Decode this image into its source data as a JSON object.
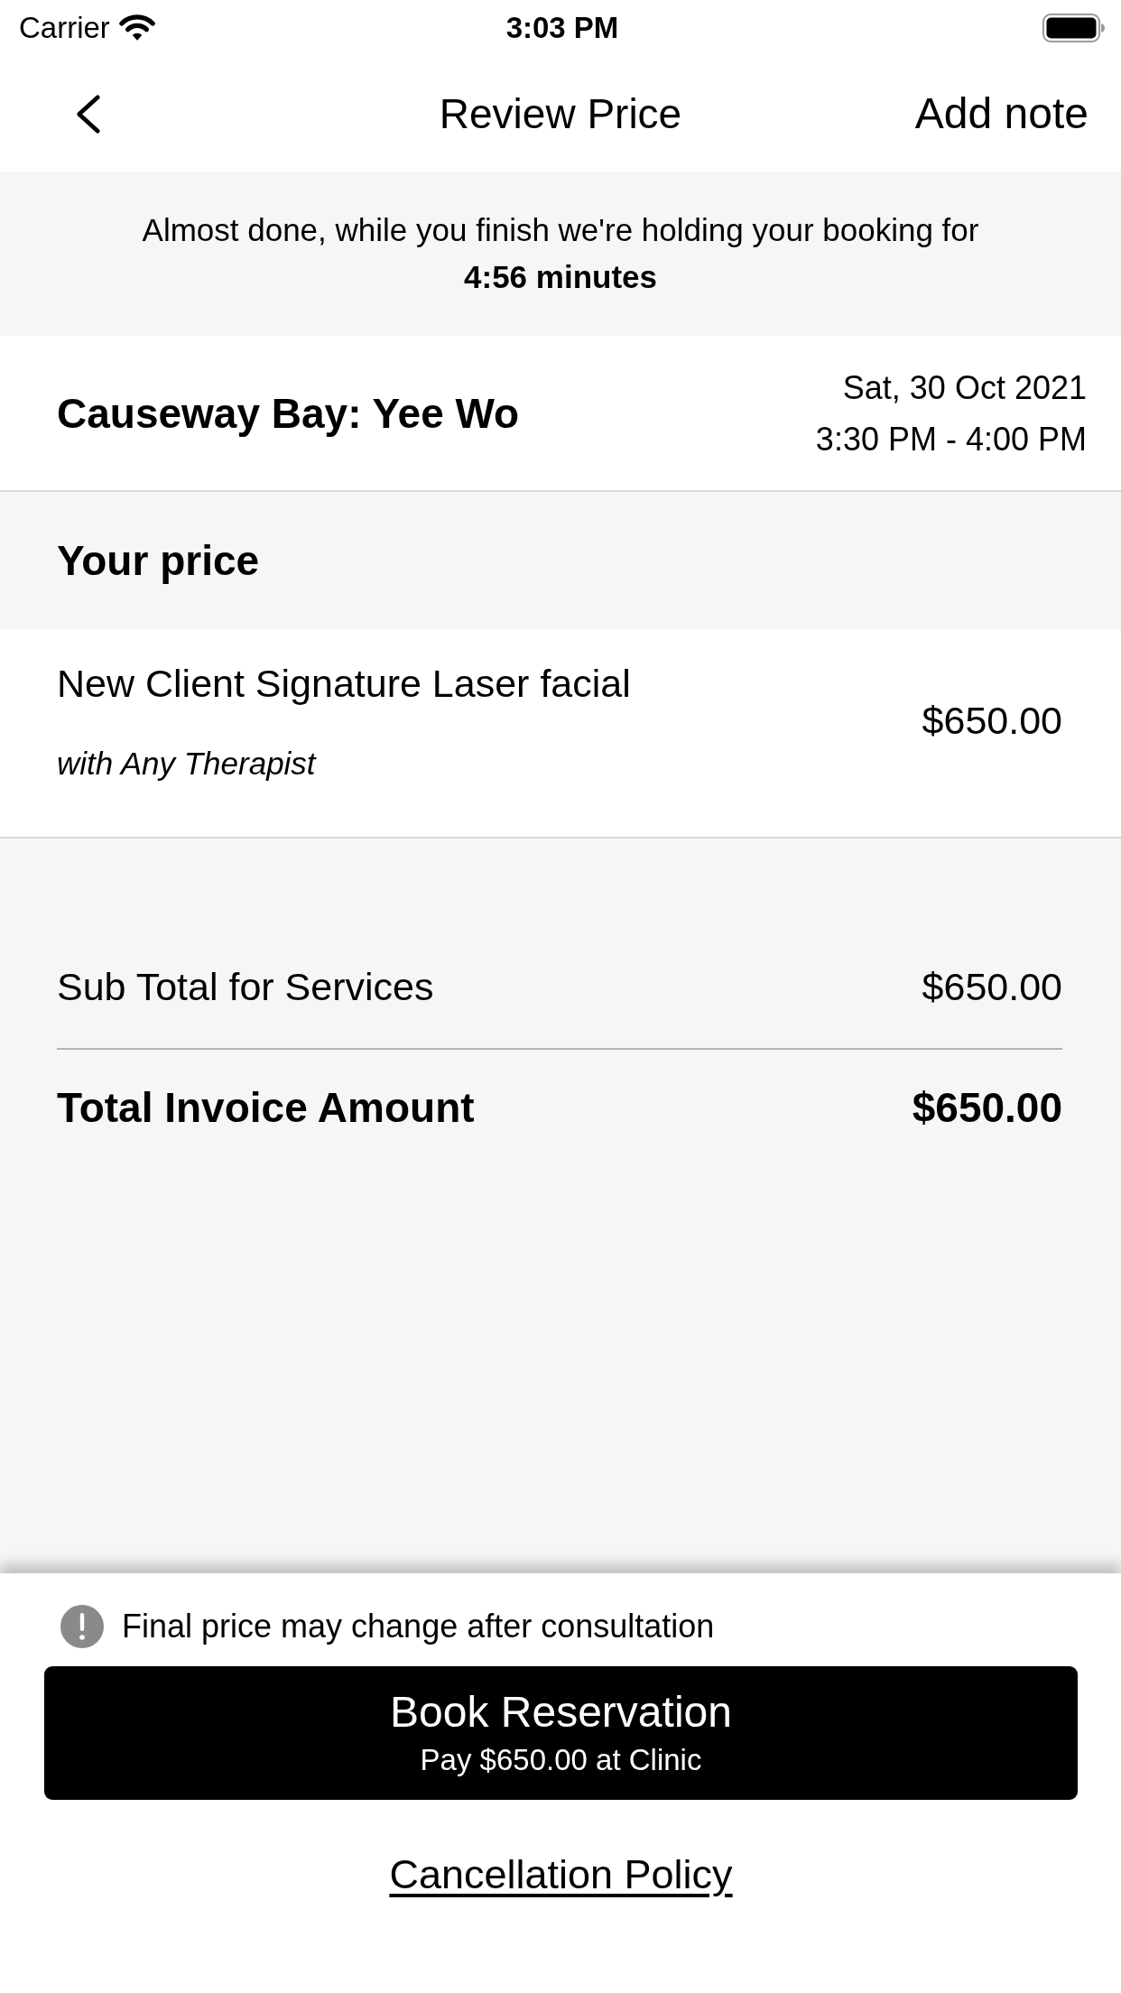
{
  "status_bar": {
    "carrier": "Carrier",
    "time": "3:03 PM"
  },
  "nav": {
    "title": "Review Price",
    "action": "Add note"
  },
  "hold_banner": {
    "message": "Almost done, while you finish we're holding your booking for",
    "countdown": "4:56 minutes"
  },
  "booking": {
    "location": "Causeway Bay: Yee Wo",
    "date": "Sat, 30 Oct 2021",
    "time": "3:30 PM - 4:00 PM"
  },
  "price_section": {
    "title": "Your price",
    "services": [
      {
        "name": "New Client Signature Laser facial",
        "staff": "with Any Therapist",
        "price": "$650.00"
      }
    ]
  },
  "totals": [
    {
      "kind": "subtotal",
      "label": "Sub Total for Services",
      "amount": "$650.00"
    },
    {
      "kind": "total",
      "label": "Total Invoice Amount",
      "amount": "$650.00"
    }
  ],
  "footer": {
    "notice": "Final price may change after consultation",
    "primary_button": {
      "label": "Book Reservation",
      "sublabel": "Pay $650.00 at Clinic"
    },
    "link": "Cancellation Policy"
  }
}
